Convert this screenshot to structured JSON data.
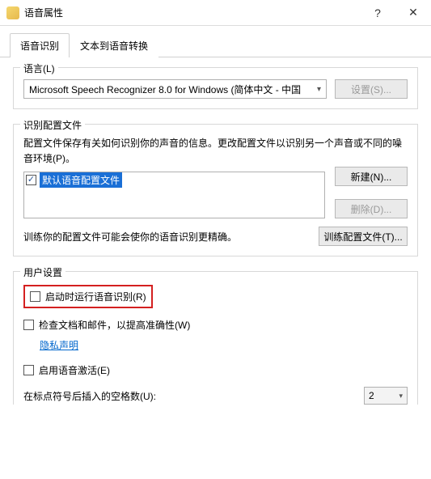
{
  "window": {
    "title": "语音属性",
    "help": "?",
    "close": "✕"
  },
  "tabs": {
    "active": "语音识别",
    "inactive": "文本到语音转换"
  },
  "language": {
    "group_title": "语言(L)",
    "selected": "Microsoft Speech Recognizer 8.0 for Windows (简体中文 - 中国",
    "settings_btn": "设置(S)..."
  },
  "profiles": {
    "group_title": "识别配置文件",
    "desc": "配置文件保存有关如何识别你的声音的信息。更改配置文件以识别另一个声音或不同的噪音环境(P)。",
    "default_item": "默认语音配置文件",
    "new_btn": "新建(N)...",
    "delete_btn": "删除(D)...",
    "train_desc": "训练你的配置文件可能会使你的语音识别更精确。",
    "train_btn": "训练配置文件(T)..."
  },
  "user": {
    "group_title": "用户设置",
    "run_at_startup": "启动时运行语音识别(R)",
    "review_docs": "检查文档和邮件，以提高准确性(W)",
    "privacy_link": "隐私声明",
    "enable_voice_activation": "启用语音激活(E)",
    "spaces_label": "在标点符号后插入的空格数(U):",
    "spaces_value": "2"
  }
}
